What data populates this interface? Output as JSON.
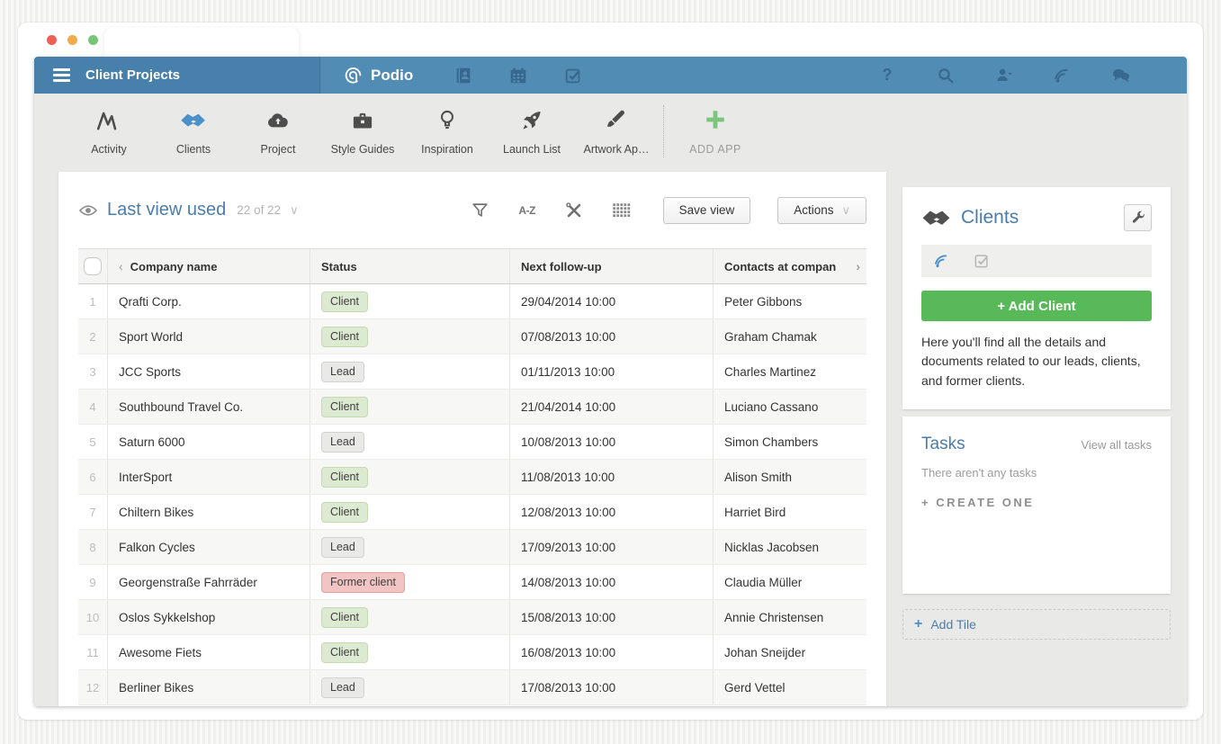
{
  "topbar": {
    "workspace_title": "Client Projects",
    "brand": "Podio",
    "nav_icons": [
      "contacts-icon",
      "calendar-icon",
      "tasks-check-icon"
    ],
    "right_icons": [
      "help-icon",
      "search-icon",
      "user-menu-icon",
      "activity-stream-icon",
      "chat-icon"
    ]
  },
  "app_nav": {
    "items": [
      {
        "label": "Activity",
        "icon": "activity-icon",
        "active": false
      },
      {
        "label": "Clients",
        "icon": "handshake-icon",
        "active": true
      },
      {
        "label": "Project",
        "icon": "cloud-icon",
        "active": false
      },
      {
        "label": "Style Guides",
        "icon": "toolbox-icon",
        "active": false
      },
      {
        "label": "Inspiration",
        "icon": "lightbulb-icon",
        "active": false
      },
      {
        "label": "Launch List",
        "icon": "rocket-icon",
        "active": false
      },
      {
        "label": "Artwork Ap…",
        "icon": "brush-icon",
        "active": false
      }
    ],
    "add_app_label": "ADD APP"
  },
  "view_header": {
    "view_name": "Last view used",
    "count": "22 of 22",
    "toolbar_icons": [
      "filter-icon",
      "sort-az-icon",
      "tools-icon",
      "grid-icon"
    ],
    "save_view_label": "Save view",
    "actions_label": "Actions"
  },
  "table": {
    "columns": [
      "Company name",
      "Status",
      "Next follow-up",
      "Contacts at compan"
    ],
    "rows": [
      {
        "num": "1",
        "company": "Qrafti Corp.",
        "status": "Client",
        "followup": "29/04/2014 10:00",
        "contact": "Peter Gibbons"
      },
      {
        "num": "2",
        "company": "Sport World",
        "status": "Client",
        "followup": "07/08/2013 10:00",
        "contact": "Graham Chamak"
      },
      {
        "num": "3",
        "company": "JCC Sports",
        "status": "Lead",
        "followup": "01/11/2013 10:00",
        "contact": "Charles Martinez"
      },
      {
        "num": "4",
        "company": "Southbound Travel Co.",
        "status": "Client",
        "followup": "21/04/2014 10:00",
        "contact": "Luciano Cassano"
      },
      {
        "num": "5",
        "company": "Saturn 6000",
        "status": "Lead",
        "followup": "10/08/2013 10:00",
        "contact": "Simon Chambers"
      },
      {
        "num": "6",
        "company": "InterSport",
        "status": "Client",
        "followup": "11/08/2013 10:00",
        "contact": "Alison Smith"
      },
      {
        "num": "7",
        "company": "Chiltern Bikes",
        "status": "Client",
        "followup": "12/08/2013 10:00",
        "contact": "Harriet Bird"
      },
      {
        "num": "8",
        "company": "Falkon Cycles",
        "status": "Lead",
        "followup": "17/09/2013 10:00",
        "contact": "Nicklas Jacobsen"
      },
      {
        "num": "9",
        "company": "Georgenstraße Fahrräder",
        "status": "Former client",
        "followup": "14/08/2013 10:00",
        "contact": "Claudia Müller"
      },
      {
        "num": "10",
        "company": "Oslos Sykkelshop",
        "status": "Client",
        "followup": "15/08/2013 10:00",
        "contact": "Annie Christensen"
      },
      {
        "num": "11",
        "company": "Awesome Fiets",
        "status": "Client",
        "followup": "16/08/2013 10:00",
        "contact": "Johan Sneijder"
      },
      {
        "num": "12",
        "company": "Berliner Bikes",
        "status": "Lead",
        "followup": "17/08/2013 10:00",
        "contact": "Gerd Vettel"
      }
    ]
  },
  "sidebar": {
    "clients_panel": {
      "title": "Clients",
      "strip_icons": [
        "stream-blue-icon",
        "checkbox-icon"
      ],
      "add_button": "+  Add Client",
      "description": "Here you'll find all the details and documents related to our leads, clients, and former clients."
    },
    "tasks_panel": {
      "title": "Tasks",
      "view_all": "View all tasks",
      "empty_text": "There aren't any tasks",
      "create_label": "+ CREATE ONE"
    },
    "add_tile_plus": "+",
    "add_tile_label": "Add Tile"
  },
  "colors": {
    "topbar_left": "#4781ab",
    "topbar_right": "#518cb5",
    "accent_blue": "#4a7dad",
    "active_icon_blue": "#4a90c9",
    "add_client_green": "#57b957",
    "badge_client_bg": "#dcead2",
    "badge_lead_bg": "#e9e9e8",
    "badge_former_bg": "#f2c4c3"
  }
}
